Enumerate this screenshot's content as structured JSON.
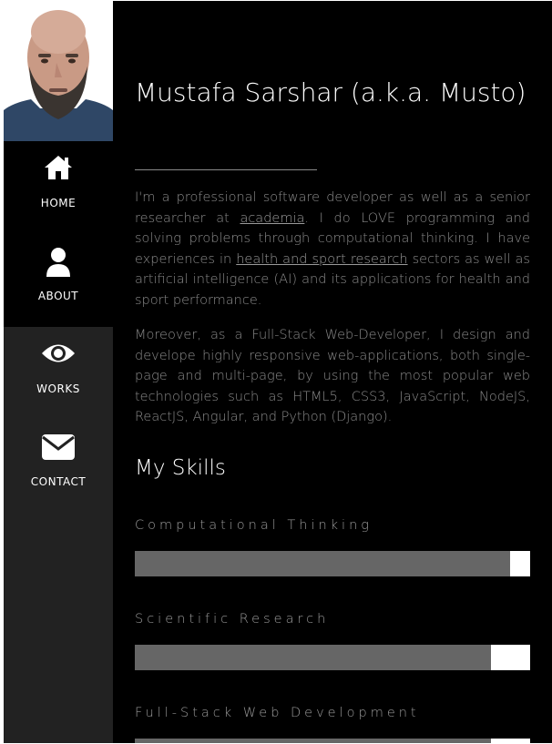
{
  "nav": [
    {
      "label": "HOME",
      "icon": "home-icon"
    },
    {
      "label": "ABOUT",
      "icon": "user-icon"
    },
    {
      "label": "WORKS",
      "icon": "eye-icon"
    },
    {
      "label": "CONTACT",
      "icon": "envelope-icon"
    }
  ],
  "profile": {
    "title": "Mustafa Sarshar (a.k.a. Musto)",
    "intro_1": "I'm a professional software developer as well as a senior researcher at ",
    "link_academia": "academia",
    "intro_2": ". I do LOVE programming and solving problems through computational thinking. I have experiences in ",
    "link_research": "health and sport research",
    "intro_3": " sectors as well as artificial intelligence (AI) and its applications for health and sport performance.",
    "paragraph_2": "Moreover, as a Full-Stack Web-Developer, I design and develope highly responsive web-applications, both single-page and multi-page, by using the most popular web technologies such as HTML5, CSS3, JavaScript, NodeJS, ReactJS, Angular, and Python (Django)."
  },
  "skills": {
    "heading": "My Skills",
    "items": [
      {
        "name": "Computational Thinking",
        "level": 0.95
      },
      {
        "name": "Scientific Research",
        "level": 0.9
      },
      {
        "name": "Full-Stack Web Development",
        "level": 0.9
      }
    ]
  },
  "colors": {
    "sidebar": "#222222",
    "background": "#000000",
    "bar_fill": "#666666",
    "bar_track": "#ffffff"
  }
}
